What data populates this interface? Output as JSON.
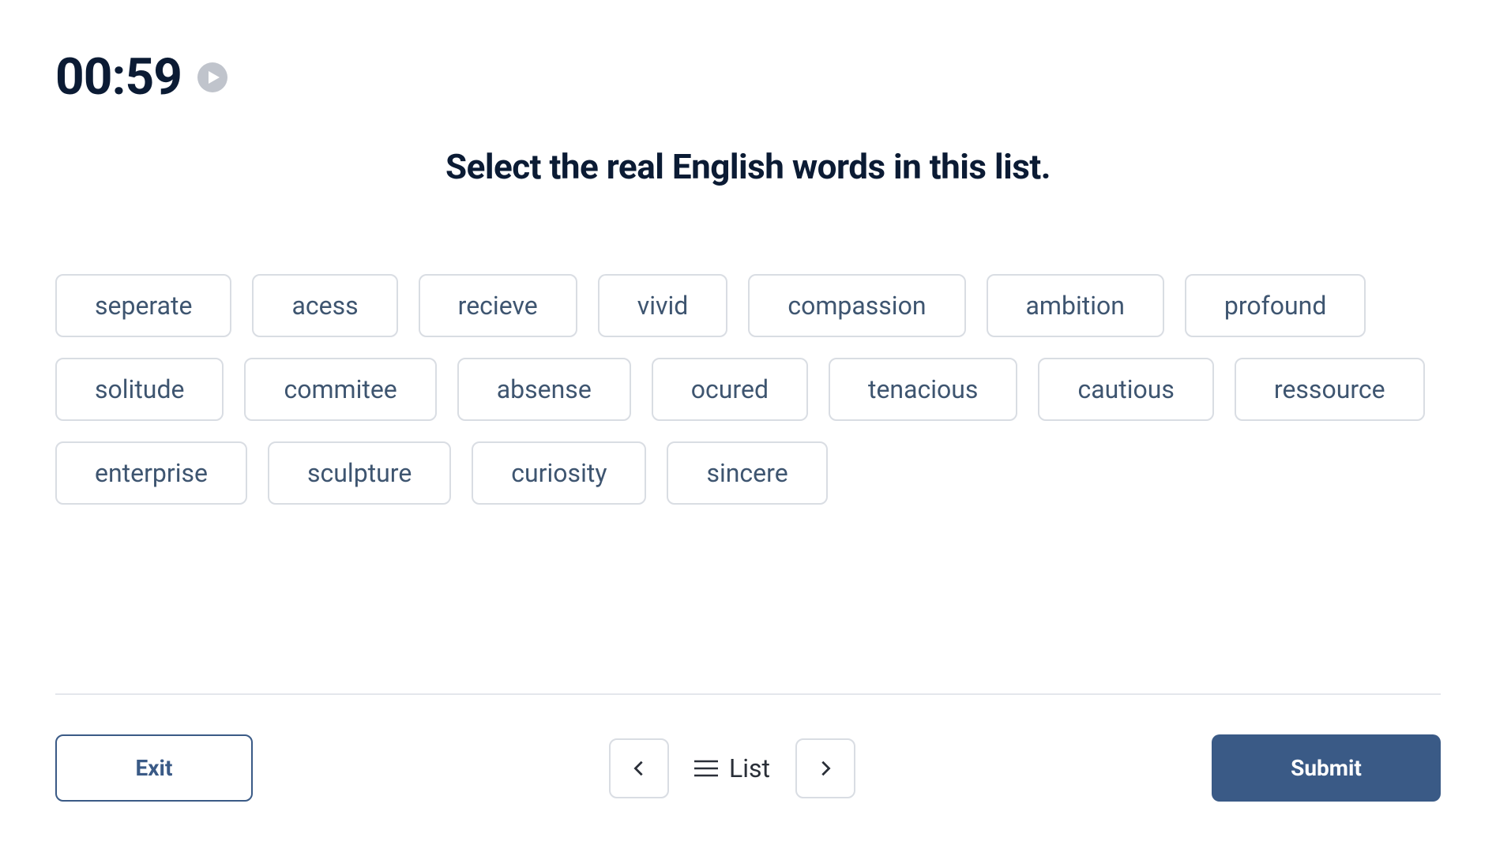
{
  "timer": "00:59",
  "prompt": "Select the real English words in this list.",
  "words": [
    "seperate",
    "acess",
    "recieve",
    "vivid",
    "compassion",
    "ambition",
    "profound",
    "solitude",
    "commitee",
    "absense",
    "ocured",
    "tenacious",
    "cautious",
    "ressource",
    "enterprise",
    "sculpture",
    "curiosity",
    "sincere"
  ],
  "footer": {
    "exit": "Exit",
    "list": "List",
    "submit": "Submit"
  }
}
